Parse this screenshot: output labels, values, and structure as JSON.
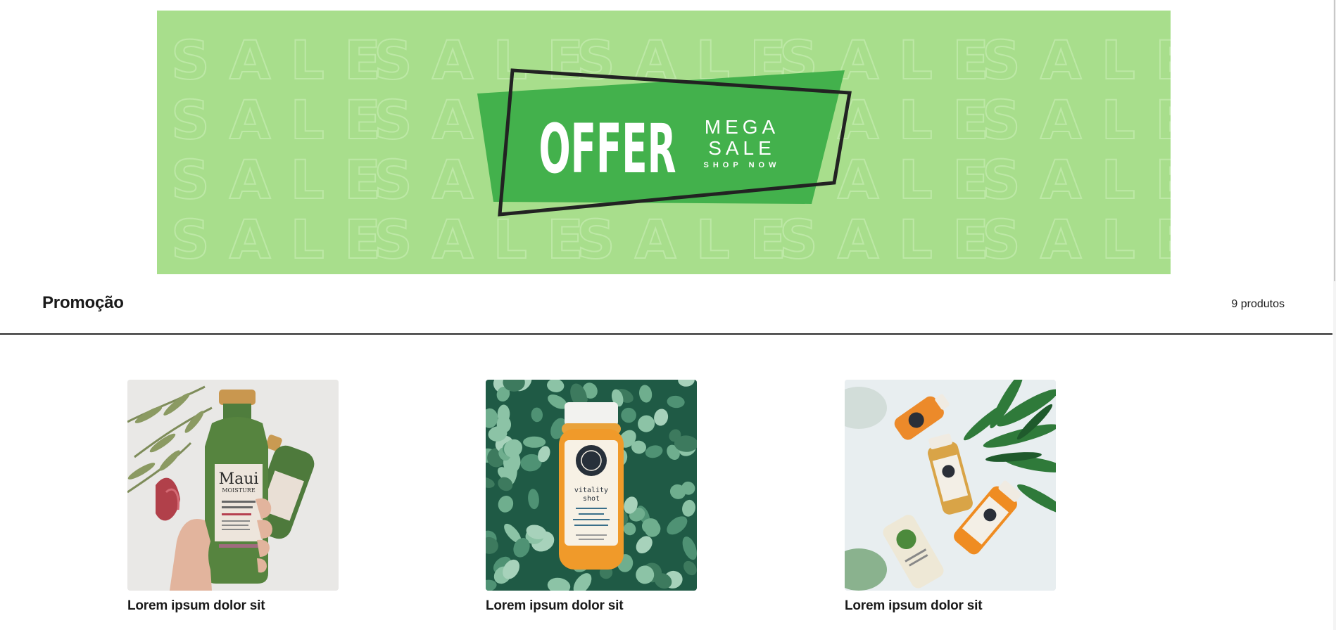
{
  "banner": {
    "headline": "OFFER",
    "line1": "MEGA",
    "line2": "SALE",
    "cta": "SHOP NOW",
    "pattern_word": "SALE",
    "background_color": "#a8de8c",
    "tag_color": "#43b14c"
  },
  "collection": {
    "title": "Promoção",
    "count_label": "9 produtos"
  },
  "products": [
    {
      "name": "Lorem ipsum dolor sit",
      "image": "shampoo-bottle-photo"
    },
    {
      "name": "Lorem ipsum dolor sit",
      "image": "juice-bottle-on-leaves-photo"
    },
    {
      "name": "Lorem ipsum dolor sit",
      "image": "juice-bottles-flatlay-photo"
    }
  ]
}
